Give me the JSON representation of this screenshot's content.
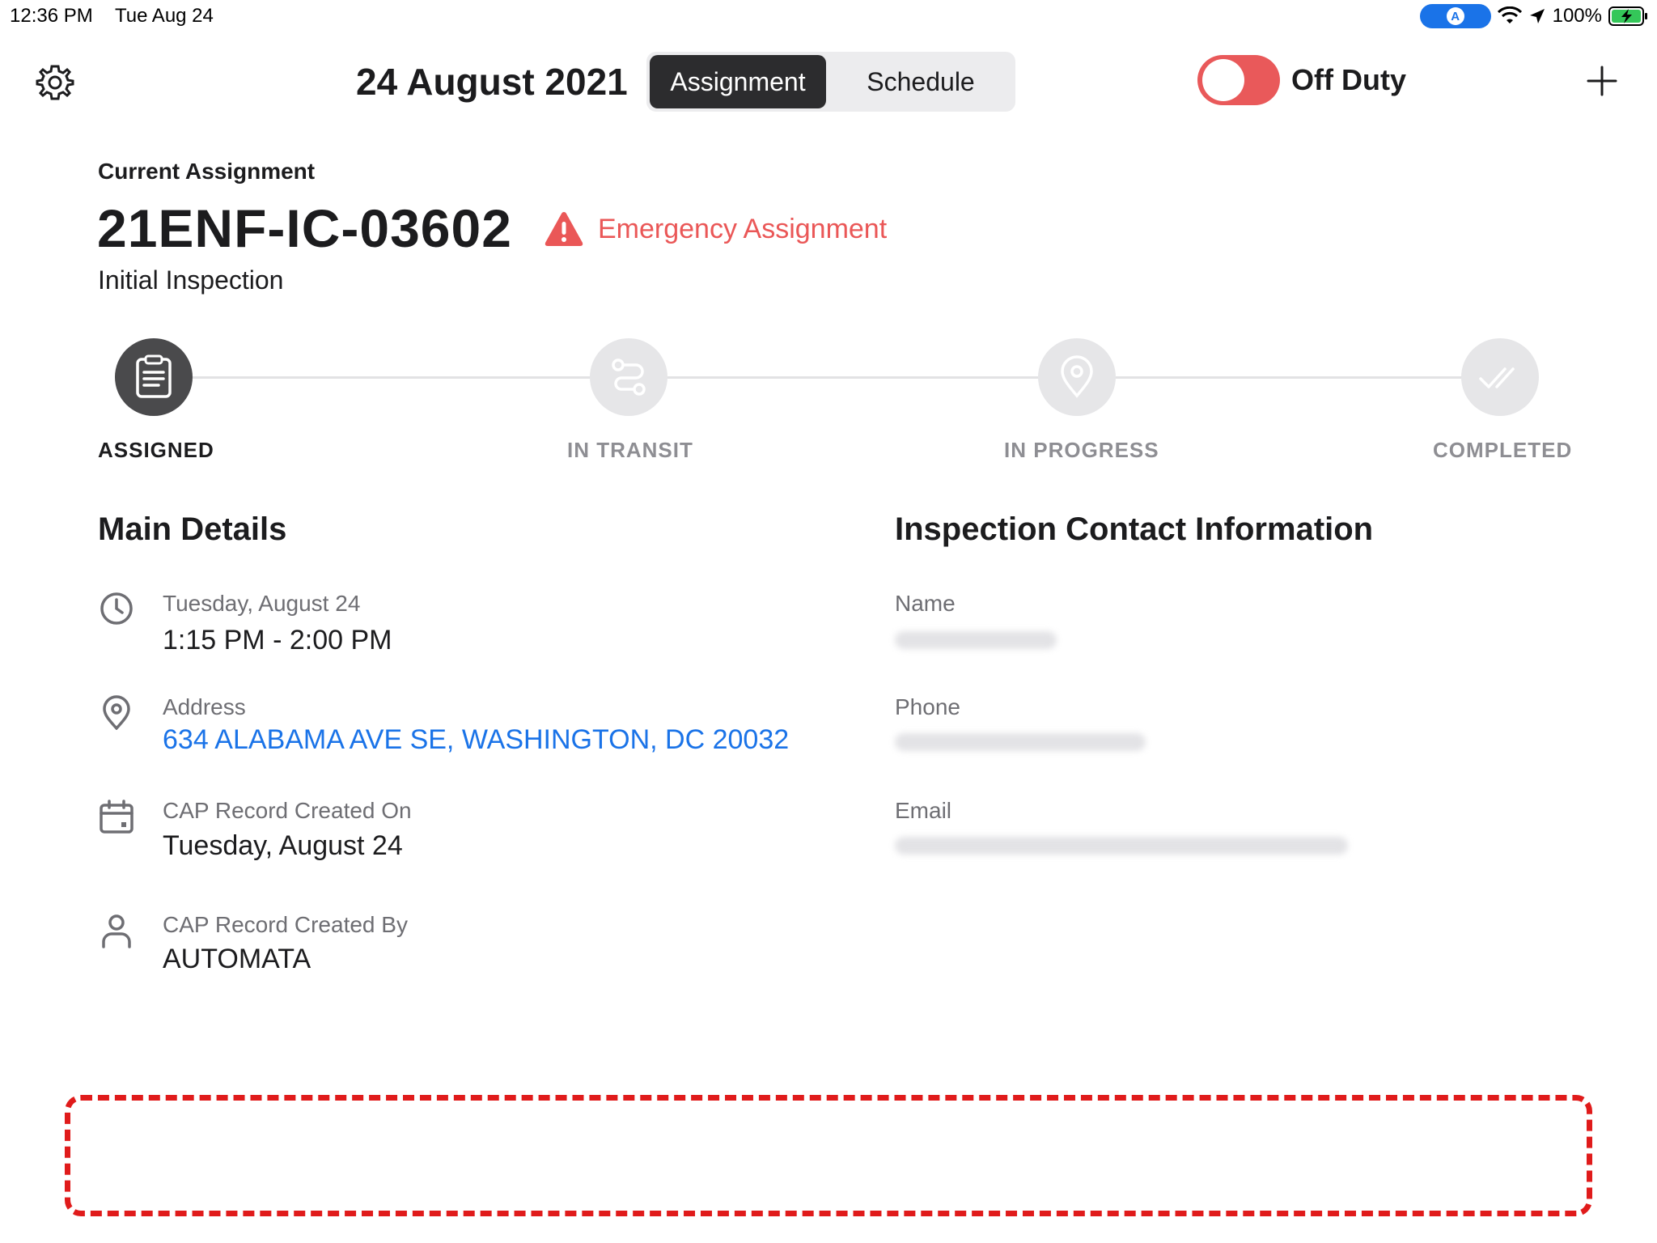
{
  "status_bar": {
    "time": "12:36 PM",
    "date": "Tue Aug 24",
    "battery": "100%"
  },
  "header": {
    "date": "24 August 2021",
    "segments": [
      "Assignment",
      "Schedule"
    ],
    "selected_segment": "Assignment",
    "duty_toggle_label": "Off Duty"
  },
  "assignment": {
    "section_label": "Current Assignment",
    "id": "21ENF-IC-03602",
    "badge": "Emergency Assignment",
    "type": "Initial Inspection"
  },
  "steps": [
    {
      "label": "ASSIGNED",
      "icon": "clipboard-icon",
      "active": true
    },
    {
      "label": "IN TRANSIT",
      "icon": "route-icon",
      "active": false
    },
    {
      "label": "IN PROGRESS",
      "icon": "location-pin-icon",
      "active": false
    },
    {
      "label": "COMPLETED",
      "icon": "double-check-icon",
      "active": false
    }
  ],
  "main_details": {
    "title": "Main Details",
    "items": [
      {
        "icon": "clock-icon",
        "label": "Tuesday, August 24",
        "value": "1:15 PM - 2:00 PM"
      },
      {
        "icon": "location-pin-icon",
        "label": "Address",
        "value": "634 ALABAMA AVE SE, WASHINGTON, DC 20032"
      },
      {
        "icon": "calendar-icon",
        "label": "CAP Record Created On",
        "value": "Tuesday, August 24"
      },
      {
        "icon": "person-icon",
        "label": "CAP Record Created By",
        "value": "AUTOMATA"
      }
    ]
  },
  "contact": {
    "title": "Inspection Contact Information",
    "fields": [
      {
        "label": "Name"
      },
      {
        "label": "Phone"
      },
      {
        "label": "Email"
      }
    ]
  },
  "colors": {
    "accent_dark": "#2c2c2e",
    "emergency_red": "#ea5757",
    "link_blue": "#1a73e8",
    "toggle_red": "#e9595a",
    "dashed_border": "#e01b1b"
  }
}
